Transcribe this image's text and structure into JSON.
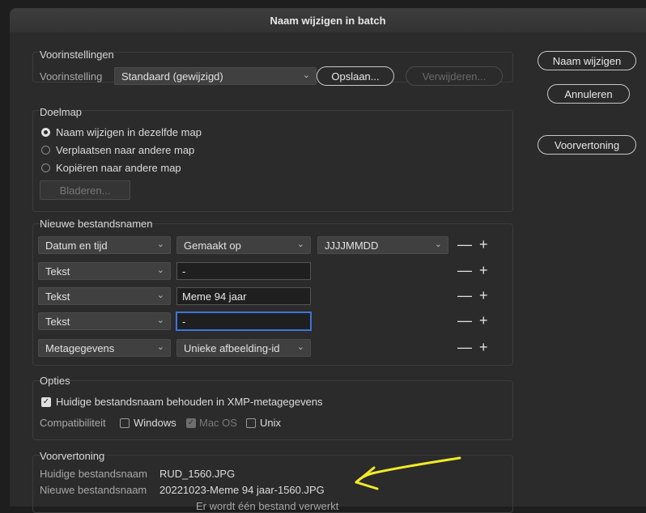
{
  "window": {
    "title": "Naam wijzigen in batch"
  },
  "presets": {
    "group_label": "Voorinstellingen",
    "field_label": "Voorinstelling",
    "value": "Standaard (gewijzigd)",
    "save_label": "Opslaan...",
    "delete_label": "Verwijderen..."
  },
  "destination": {
    "group_label": "Doelmap",
    "options": [
      "Naam wijzigen in dezelfde map",
      "Verplaatsen naar andere map",
      "Kopiëren naar andere map"
    ],
    "selected": 0,
    "browse_label": "Bladeren..."
  },
  "new_names": {
    "group_label": "Nieuwe bestandsnamen",
    "rows": [
      {
        "type": "Datum en tijd",
        "value": "Gemaakt op",
        "format": "JJJJMMDD"
      },
      {
        "type": "Tekst",
        "value": "-"
      },
      {
        "type": "Tekst",
        "value": "Meme 94 jaar"
      },
      {
        "type": "Tekst",
        "value": "-"
      },
      {
        "type": "Metagegevens",
        "value": "Unieke afbeelding-id"
      }
    ],
    "minus": "—",
    "plus": "+"
  },
  "options": {
    "group_label": "Opties",
    "keep_name_label": "Huidige bestandsnaam behouden in XMP-metagegevens",
    "keep_name_checked": true,
    "compat_label": "Compatibiliteit",
    "compat": [
      {
        "label": "Windows",
        "checked": false
      },
      {
        "label": "Mac OS",
        "checked": true,
        "disabled": true
      },
      {
        "label": "Unix",
        "checked": false
      }
    ]
  },
  "preview": {
    "group_label": "Voorvertoning",
    "current_label": "Huidige bestandsnaam",
    "current_value": "RUD_1560.JPG",
    "new_label": "Nieuwe bestandsnaam",
    "new_value": "20221023-Meme 94 jaar-1560.JPG",
    "footer": "Er wordt één bestand verwerkt"
  },
  "side_buttons": {
    "rename": "Naam wijzigen",
    "cancel": "Annuleren",
    "preview": "Voorvertoning"
  },
  "annotation": {
    "arrow_color": "#f4ea2a"
  }
}
